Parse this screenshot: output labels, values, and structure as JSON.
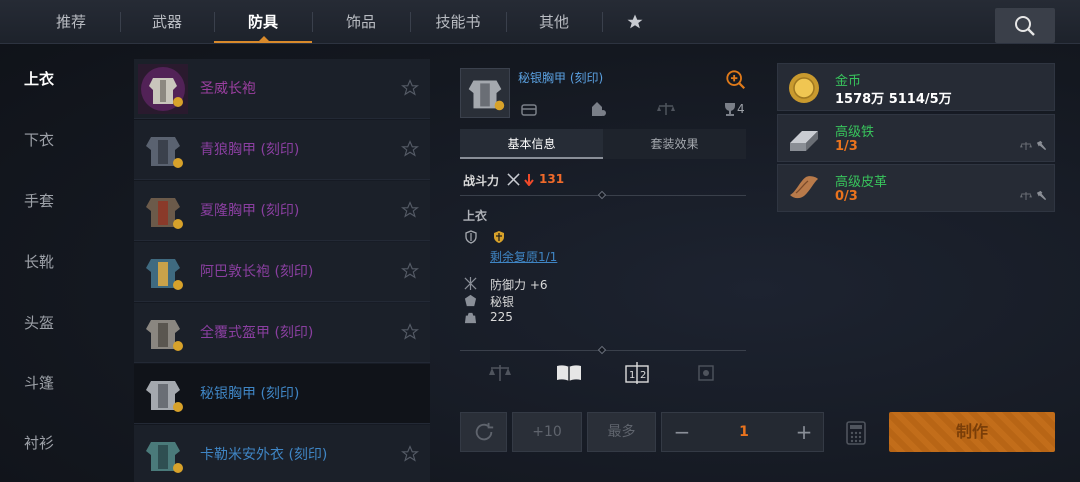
{
  "tabs": [
    {
      "label": "推荐"
    },
    {
      "label": "武器"
    },
    {
      "label": "防具"
    },
    {
      "label": "饰品"
    },
    {
      "label": "技能书"
    },
    {
      "label": "其他"
    }
  ],
  "active_tab": "防具",
  "categories": [
    "上衣",
    "下衣",
    "手套",
    "长靴",
    "头盔",
    "斗篷",
    "衬衫"
  ],
  "active_category": "上衣",
  "items": [
    {
      "name": "圣威长袍",
      "color": "#9b3fa0"
    },
    {
      "name": "青狼胸甲 (刻印)",
      "color": "#8a3fa0"
    },
    {
      "name": "夏隆胸甲 (刻印)",
      "color": "#8a3fa0"
    },
    {
      "name": "阿巴敦长袍 (刻印)",
      "color": "#8a3fa0"
    },
    {
      "name": "全覆式盔甲 (刻印)",
      "color": "#8a3fa0"
    },
    {
      "name": "秘银胸甲 (刻印)",
      "color": "#3f85c4"
    },
    {
      "name": "卡勒米安外衣 (刻印)",
      "color": "#3f85c4"
    }
  ],
  "detail": {
    "name": "秘银胸甲 (刻印)",
    "trade_count": "4",
    "subtabs": [
      "基本信息",
      "套装效果"
    ],
    "power_label": "战斗力",
    "power_value": "131",
    "slot": "上衣",
    "restore_link": "剩余复原1/1",
    "stats": [
      {
        "icon": "defense-icon",
        "text": "防御力 +6"
      },
      {
        "icon": "material-icon",
        "text": "秘银"
      },
      {
        "icon": "weight-icon",
        "text": "225"
      }
    ]
  },
  "materials": [
    {
      "name": "金币",
      "value": "1578万 5114/5万",
      "value_color": "#ffffff"
    },
    {
      "name": "高级铁",
      "value": "1/3",
      "value_color": "#e9731e"
    },
    {
      "name": "高级皮革",
      "value": "0/3",
      "value_color": "#e9731e"
    }
  ],
  "controls": {
    "plus10": "+10",
    "max": "最多",
    "minus": "−",
    "quantity": "1",
    "plus": "+",
    "craft": "制作"
  },
  "colors": {
    "accent": "#d98a2b",
    "blue_name": "#3f85c4",
    "purple_name": "#8a3fa0",
    "green": "#38c45c",
    "orange": "#e9731e"
  }
}
